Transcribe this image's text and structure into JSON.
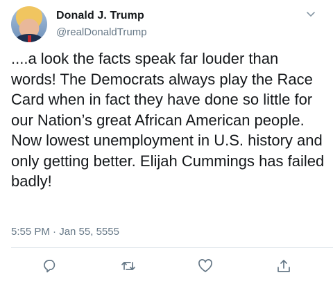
{
  "author": {
    "display_name": "Donald J. Trump",
    "handle": "@realDonaldTrump"
  },
  "tweet": {
    "text": "....a look the facts speak far louder than words! The Democrats always play the Race Card when in fact they have done so little for our Nation’s great African American people. Now lowest unemployment in U.S. history and only getting better. Elijah Cummings has failed badly!",
    "timestamp": "5:55 PM · Jan 55, 5555"
  },
  "icons": {
    "more": "chevron-down-icon",
    "reply": "reply-icon",
    "retweet": "retweet-icon",
    "like": "heart-icon",
    "share": "share-icon"
  },
  "colors": {
    "text": "#14171a",
    "secondary": "#657786",
    "divider": "#e1e8ed"
  }
}
